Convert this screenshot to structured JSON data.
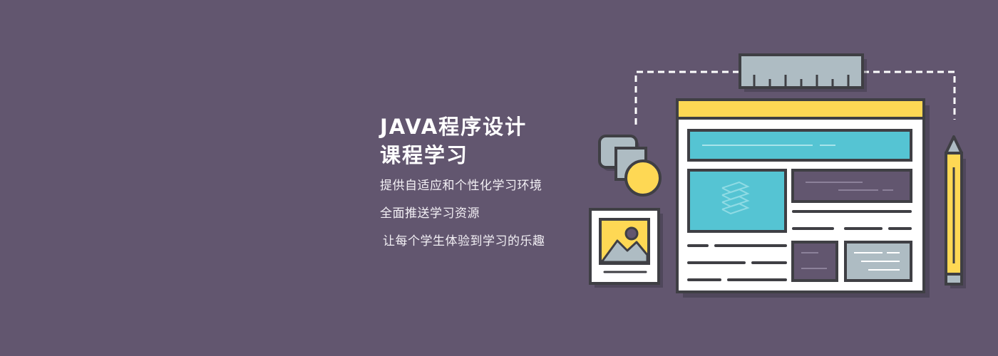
{
  "banner": {
    "title_line1": "JAVA程序设计",
    "title_line2": "课程学习",
    "subtitle_line1": "提供自适应和个性化学习环境",
    "subtitle_line2": "全面推送学习资源",
    "subtitle_line3": "让每个学生体验到学习的乐趣"
  },
  "colors": {
    "background": "#62566f",
    "accent_yellow": "#fed854",
    "accent_cyan": "#55c4d3",
    "accent_gray": "#aebcc3",
    "accent_purple": "#62566f",
    "outline": "#3f3f44",
    "paper": "#ffffff"
  },
  "icons": [
    "ruler-icon",
    "browser-window-icon",
    "pencil-icon",
    "photo-frame-icon",
    "shapes-icon"
  ]
}
